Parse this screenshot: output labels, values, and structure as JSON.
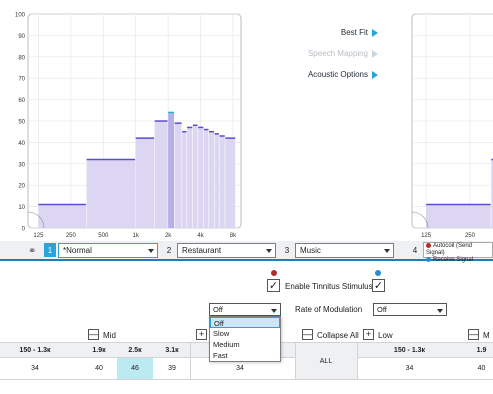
{
  "chart_left": {
    "type": "bar",
    "y_ticks": [
      "0",
      "10",
      "20",
      "30",
      "40",
      "50",
      "60",
      "70",
      "80",
      "90",
      "100"
    ],
    "x_ticks": [
      "125",
      "250",
      "500",
      "1k",
      "2k",
      "4k",
      "8k"
    ],
    "ylim": [
      0,
      100
    ],
    "bands": [
      {
        "from_hz": 125,
        "to_hz": 350,
        "value": 11
      },
      {
        "from_hz": 350,
        "to_hz": 1000,
        "value": 32
      },
      {
        "from_hz": 1000,
        "to_hz": 1500,
        "value": 42
      },
      {
        "from_hz": 1500,
        "to_hz": 2000,
        "value": 50
      },
      {
        "from_hz": 2000,
        "to_hz": 2300,
        "value": 54
      },
      {
        "from_hz": 2300,
        "to_hz": 2700,
        "value": 49
      },
      {
        "from_hz": 2700,
        "to_hz": 3000,
        "value": 45
      },
      {
        "from_hz": 3000,
        "to_hz": 3400,
        "value": 47
      },
      {
        "from_hz": 3400,
        "to_hz": 3800,
        "value": 48
      },
      {
        "from_hz": 3800,
        "to_hz": 4300,
        "value": 47
      },
      {
        "from_hz": 4300,
        "to_hz": 4800,
        "value": 46
      },
      {
        "from_hz": 4800,
        "to_hz": 5400,
        "value": 45
      },
      {
        "from_hz": 5400,
        "to_hz": 6000,
        "value": 44
      },
      {
        "from_hz": 6000,
        "to_hz": 6800,
        "value": 43
      },
      {
        "from_hz": 6800,
        "to_hz": 8500,
        "value": 42
      }
    ],
    "highlight_band_hz": [
      2000,
      2300
    ],
    "colors": {
      "fill": "#dcd6f3",
      "line": "#5a4fcf",
      "highlight": "#b7aee8",
      "top_highlight": "#21b5c6",
      "grid": "#e2e4e8"
    }
  },
  "chart_right": {
    "x_ticks": [
      "125",
      "250",
      "50"
    ],
    "bands": [
      {
        "from_hz": 125,
        "to_hz": 350,
        "value": 11
      },
      {
        "from_hz": 350,
        "to_hz": 600,
        "value": 32
      }
    ]
  },
  "side_menu": [
    {
      "label": "Best Fit",
      "disabled": false
    },
    {
      "label": "Speech Mapping",
      "disabled": true
    },
    {
      "label": "Acoustic Options",
      "disabled": false
    }
  ],
  "programs": [
    {
      "num": "1",
      "name": "*Normal",
      "active": true
    },
    {
      "num": "2",
      "name": "Restaurant",
      "active": false
    },
    {
      "num": "3",
      "name": "Music",
      "active": false
    },
    {
      "num": "4",
      "name": "",
      "active": false
    }
  ],
  "legend": {
    "line1": "Autocoil (Send Signal)",
    "line2": "Receive Signal",
    "color1": "#b32b2b",
    "color2": "#2a8ad4"
  },
  "tinnitus": {
    "label": "Enable Tinnitus Stimulus",
    "left_dot_color": "#b32b2b",
    "right_dot_color": "#2a8ad4",
    "check_mark": "✓"
  },
  "stimulus_select": {
    "value": "Off"
  },
  "rate_modulation": {
    "label": "Rate of Modulation",
    "value": "Off"
  },
  "dropdown_options": [
    "Off",
    "Slow",
    "Medium",
    "Fast"
  ],
  "groups": {
    "mid": "Mid",
    "collapse_all": "Collapse All",
    "low": "Low",
    "right_cut": "M",
    "minus": "—",
    "plus": "+"
  },
  "table": {
    "headers_left": [
      "150 - 1.3к",
      "1.9к",
      "2.5к",
      "3.1к"
    ],
    "values_left": [
      "34",
      "40",
      "46",
      "39"
    ],
    "middle_value": "34",
    "all_label": "ALL",
    "header_right": "150 - 1.3к",
    "value_right": "34",
    "header_right_cut": "1.9",
    "value_right_cut": "40"
  }
}
